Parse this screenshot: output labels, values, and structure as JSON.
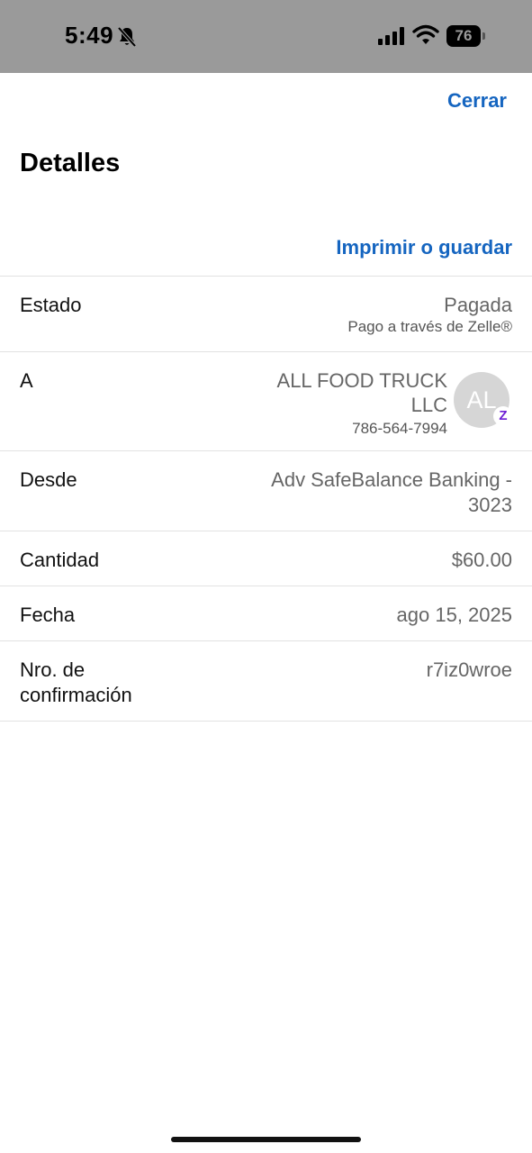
{
  "status_bar": {
    "time": "5:49",
    "battery": "76",
    "icons": [
      "bell-slash-icon",
      "cellular-signal-icon",
      "wifi-icon",
      "battery-icon"
    ]
  },
  "header": {
    "close_label": "Cerrar",
    "title": "Detalles",
    "print_label": "Imprimir o guardar"
  },
  "details": {
    "estado": {
      "label": "Estado",
      "value": "Pagada",
      "sub": "Pago a través de Zelle®"
    },
    "a": {
      "label": "A",
      "name": "ALL FOOD TRUCK LLC",
      "phone": "786-564-7994",
      "avatar_initials": "AL",
      "badge": "Z"
    },
    "desde": {
      "label": "Desde",
      "value": "Adv SafeBalance Banking - 3023"
    },
    "cantidad": {
      "label": "Cantidad",
      "value": "$60.00"
    },
    "fecha": {
      "label": "Fecha",
      "value": "ago 15, 2025"
    },
    "confirmacion": {
      "label": "Nro. de confirmación",
      "value": "r7iz0wroe"
    }
  },
  "colors": {
    "accent": "#1565c0",
    "status_bar_bg": "#9a9a9a",
    "zelle_purple": "#6d1ed4"
  }
}
